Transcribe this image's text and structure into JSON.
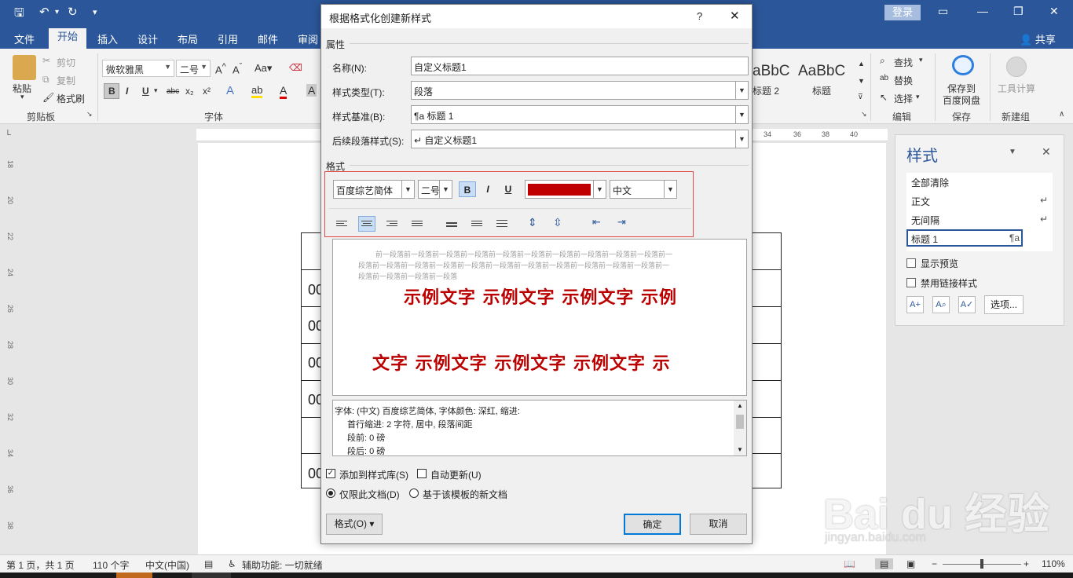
{
  "titlebar": {
    "login": "登录"
  },
  "tabs": [
    "文件",
    "开始",
    "插入",
    "设计",
    "布局",
    "引用",
    "邮件",
    "审阅"
  ],
  "share": "共享",
  "ribbon": {
    "clipboard": {
      "paste": "粘贴",
      "cut": "剪切",
      "copy": "复制",
      "painter": "格式刷",
      "group": "剪贴板"
    },
    "font": {
      "name": "微软雅黑",
      "size": "二号",
      "group": "字体",
      "b": "B",
      "i": "I",
      "u": "U",
      "abc": "abc",
      "x2": "x₂",
      "x2s": "x²"
    },
    "gallery": {
      "style1_sample": "aBbC",
      "style1_name": "标题 2",
      "style2_sample": "AaBbC",
      "style2_name": "标题"
    },
    "editing": {
      "find": "查找",
      "replace": "替换",
      "select": "选择",
      "group": "编辑"
    },
    "save": {
      "label": "保存到\n百度网盘",
      "l1": "保存到",
      "l2": "百度网盘",
      "group": "保存"
    },
    "tools": {
      "label": "工具计算",
      "group": "新建组"
    }
  },
  "ruler": {
    "marks": [
      "34",
      "36",
      "38",
      "40"
    ],
    "vmarks": [
      "18",
      "20",
      "22",
      "24",
      "26",
      "28",
      "30",
      "32",
      "34",
      "36",
      "38"
    ]
  },
  "document": {
    "cells": [
      "00",
      "00",
      "00",
      "00",
      "00"
    ]
  },
  "styles_pane": {
    "title": "样式",
    "items": [
      {
        "label": "全部清除",
        "mark": ""
      },
      {
        "label": "正文",
        "mark": "↵"
      },
      {
        "label": "无间隔",
        "mark": "↵"
      },
      {
        "label": "标题 1",
        "mark": "¶a"
      }
    ],
    "show_preview": "显示预览",
    "disable_linked": "禁用链接样式",
    "options": "选项..."
  },
  "status": {
    "page": "第 1 页，共 1 页",
    "words": "110 个字",
    "lang": "中文(中国)",
    "access": "辅助功能: 一切就绪",
    "zoom": "110%"
  },
  "dialog": {
    "title": "根据格式化创建新样式",
    "help": "?",
    "properties": "属性",
    "name_label": "名称(N):",
    "name_value": "自定义标题1",
    "type_label": "样式类型(T):",
    "type_value": "段落",
    "base_label": "样式基准(B):",
    "base_value": "¶a 标题 1",
    "next_label": "后续段落样式(S):",
    "next_value": "↵ 自定义标题1",
    "format_section": "格式",
    "font": "百度综艺简体",
    "size": "二号",
    "bold": "B",
    "italic": "I",
    "underline": "U",
    "color": "#c00000",
    "script": "中文",
    "preview_prev": [
      "前一段落前一段落前一段落前一段落前一段落前一段落前一段落前一段落前一段落前一段落前一",
      "段落前一段落前一段落前一段落前一段落前一段落前一段落前一段落前一段落前一段落前一段落前一",
      "段落前一段落前一段落前一段落"
    ],
    "sample_line1": "示例文字 示例文字 示例文字 示例",
    "sample_line2": "文字 示例文字 示例文字 示例文字 示",
    "desc": [
      "字体: (中文) 百度综艺简体, 字体颜色: 深红, 缩进:",
      "首行缩进:  2 字符, 居中, 段落间距",
      "段前: 0 磅",
      "段后: 0 磅"
    ],
    "add_gallery": "添加到样式库(S)",
    "auto_update": "自动更新(U)",
    "only_doc": "仅限此文档(D)",
    "template": "基于该模板的新文档",
    "format_btn": "格式(O)",
    "ok": "确定",
    "cancel": "取消"
  },
  "watermark": {
    "logo": "Bai du 经验",
    "url": "jingyan.baidu.com"
  }
}
